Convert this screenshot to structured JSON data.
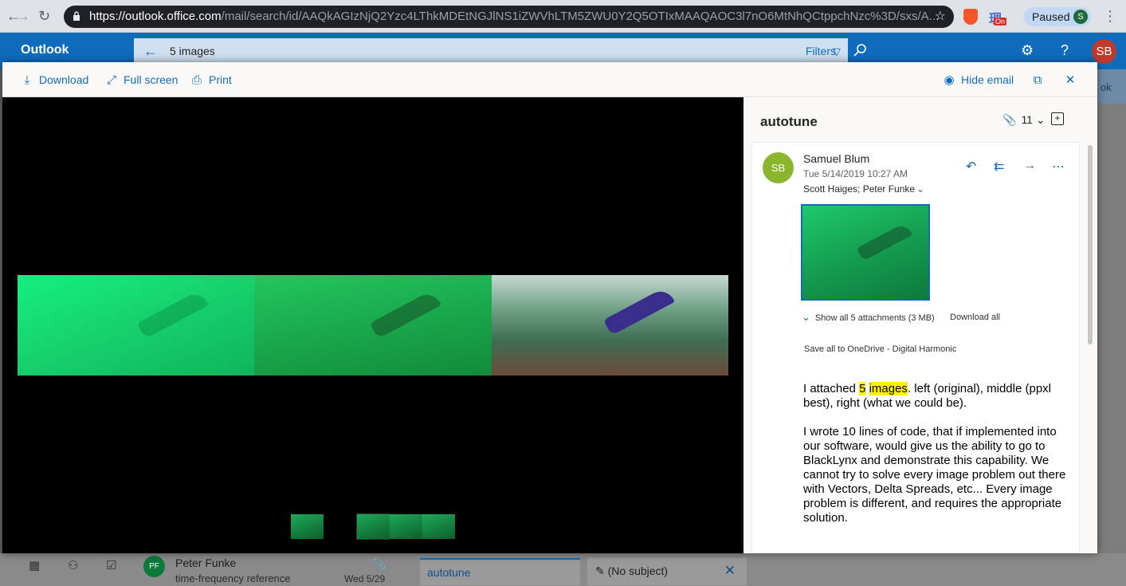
{
  "browser": {
    "url_host": "https://outlook.office.com",
    "url_path": "/mail/search/id/AAQkAGIzNjQ2Yzc4LThkMDEtNGJlNS1iZWVhLTM5ZWU0Y2Q5OTIxMAAQAOC3l7nO6MtNhQCtppchNzc%3D/sxs/A...",
    "profile_label": "Paused",
    "profile_initial": "S",
    "ext_badge": "On"
  },
  "outlook": {
    "brand": "Outlook",
    "search_query": "5 images",
    "filters_label": "Filters",
    "user_initials": "SB"
  },
  "viewer_toolbar": {
    "download": "Download",
    "fullscreen": "Full screen",
    "print": "Print",
    "hide_email": "Hide email"
  },
  "mail": {
    "subject": "autotune",
    "count": "11",
    "sender_initials": "SB",
    "sender": "Samuel Blum",
    "date": "Tue 5/14/2019 10:27 AM",
    "recipients": "Scott Haiges; Peter Funke",
    "show_all": "Show all 5 attachments (3 MB)",
    "download_all": "Download all",
    "save_onedrive": "Save all to OneDrive - Digital Harmonic",
    "body_p1_pre": "I attached ",
    "body_p1_hl1": "5",
    "body_p1_hl2": "images",
    "body_p1_post": ". left (original), middle (ppxl best), right (what we could be).",
    "body_p2": "I wrote 10 lines of code, that if implemented into our software, would give us the ability to go to BlackLynx and demonstrate this capability. We cannot try to solve every image problem out there with Vectors, Delta Spreads, etc... Every image problem is different, and requires the appropriate solution."
  },
  "background": {
    "list_item_initials": "PF",
    "list_item_name": "Peter Funke",
    "list_item_subject": "time-frequency reference",
    "list_item_date": "Wed 5/29",
    "tab1": "autotune",
    "tab2": "(No subject)",
    "right_tab": "ok"
  },
  "colors": {
    "accent": "#0f6cbd",
    "highlight": "#fff100",
    "sender_avatar": "#8bb52c"
  }
}
